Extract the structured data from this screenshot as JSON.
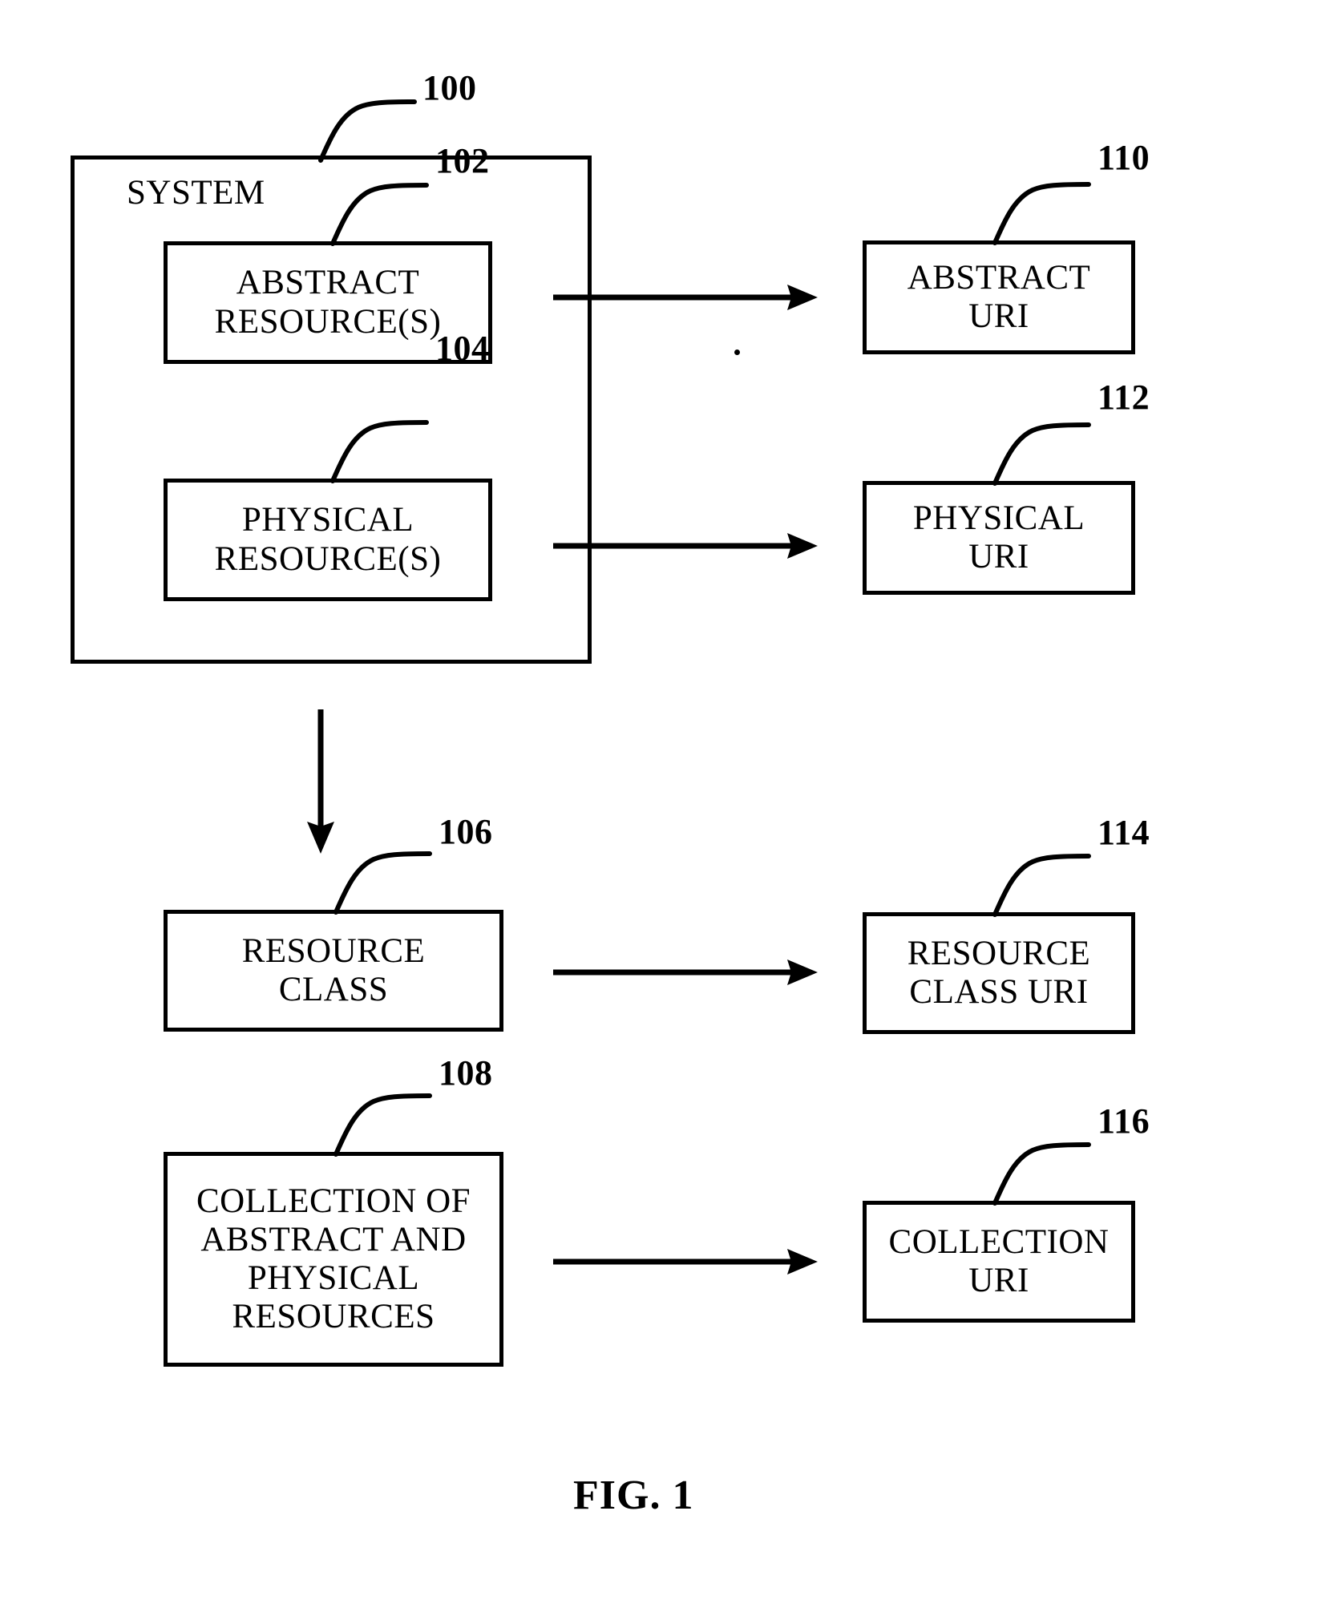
{
  "figure": {
    "caption": "FIG. 1",
    "system_label": "SYSTEM"
  },
  "nodes": [
    {
      "id": "system",
      "ref": "100",
      "label": "SYSTEM"
    },
    {
      "id": "abstract_resource",
      "ref": "102",
      "label": "ABSTRACT\nRESOURCE(S)"
    },
    {
      "id": "physical_resource",
      "ref": "104",
      "label": "PHYSICAL\nRESOURCE(S)"
    },
    {
      "id": "resource_class",
      "ref": "106",
      "label": "RESOURCE\nCLASS"
    },
    {
      "id": "collection",
      "ref": "108",
      "label": "COLLECTION OF\nABSTRACT AND\nPHYSICAL\nRESOURCES"
    },
    {
      "id": "abstract_uri",
      "ref": "110",
      "label": "ABSTRACT\nURI"
    },
    {
      "id": "physical_uri",
      "ref": "112",
      "label": "PHYSICAL\nURI"
    },
    {
      "id": "resource_class_uri",
      "ref": "114",
      "label": "RESOURCE\nCLASS URI"
    },
    {
      "id": "collection_uri",
      "ref": "116",
      "label": "COLLECTION\nURI"
    }
  ],
  "refs": {
    "system": "100",
    "abstract_resource": "102",
    "physical_resource": "104",
    "resource_class": "106",
    "collection": "108",
    "abstract_uri": "110",
    "physical_uri": "112",
    "resource_class_uri": "114",
    "collection_uri": "116"
  },
  "labels": {
    "system": "SYSTEM",
    "abstract_resource": "ABSTRACT\nRESOURCE(S)",
    "physical_resource": "PHYSICAL\nRESOURCE(S)",
    "resource_class": "RESOURCE\nCLASS",
    "collection": "COLLECTION OF\nABSTRACT AND\nPHYSICAL\nRESOURCES",
    "abstract_uri": "ABSTRACT\nURI",
    "physical_uri": "PHYSICAL\nURI",
    "resource_class_uri": "RESOURCE\nCLASS URI",
    "collection_uri": "COLLECTION\nURI"
  },
  "connections": [
    {
      "id": "abstract-to-abstract-uri",
      "from": "abstract_resource",
      "to": "abstract_uri",
      "direction": "right"
    },
    {
      "id": "physical-to-physical-uri",
      "from": "physical_resource",
      "to": "physical_uri",
      "direction": "right"
    },
    {
      "id": "system-to-resource-class",
      "from": "system",
      "to": "resource_class",
      "direction": "down"
    },
    {
      "id": "class-to-class-uri",
      "from": "resource_class",
      "to": "resource_class_uri",
      "direction": "right"
    },
    {
      "id": "collection-to-collection-uri",
      "from": "collection",
      "to": "collection_uri",
      "direction": "right"
    }
  ],
  "style": {
    "ink": "#000000",
    "paper": "#ffffff"
  }
}
